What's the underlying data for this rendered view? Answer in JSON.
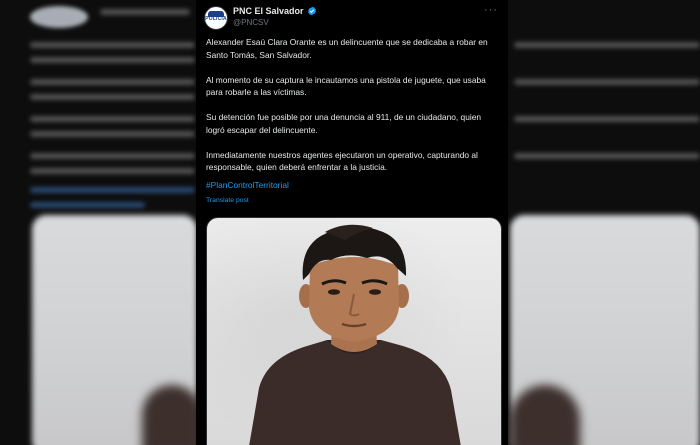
{
  "tweet": {
    "display_name": "PNC El Salvador",
    "handle": "@PNCSV",
    "avatar_text": "POLICÍA",
    "more_label": "···",
    "paragraphs": [
      "Alexander Esaú Clara Orante es un delincuente que se dedicaba a robar en Santo Tomás, San Salvador.",
      "Al momento de su captura le incautamos una pistola de juguete, que usaba para robarle a las víctimas.",
      "Su detención fue posible por una denuncia al 911, de un ciudadano, quien logró escapar del delincuente.",
      "Inmediatamente nuestros agentes ejecutaron un operativo, capturando al responsable, quien deberá enfrentar a la justicia."
    ],
    "hashtag": "#PlanControlTerritorial",
    "translate_label": "Translate post",
    "colors": {
      "link": "#1d9bf0",
      "verified": "#1d9bf0",
      "text": "#e7e9ea",
      "muted": "#71767b",
      "background": "#000000"
    },
    "icons": [
      "verified-badge-icon",
      "more-options-icon"
    ]
  }
}
